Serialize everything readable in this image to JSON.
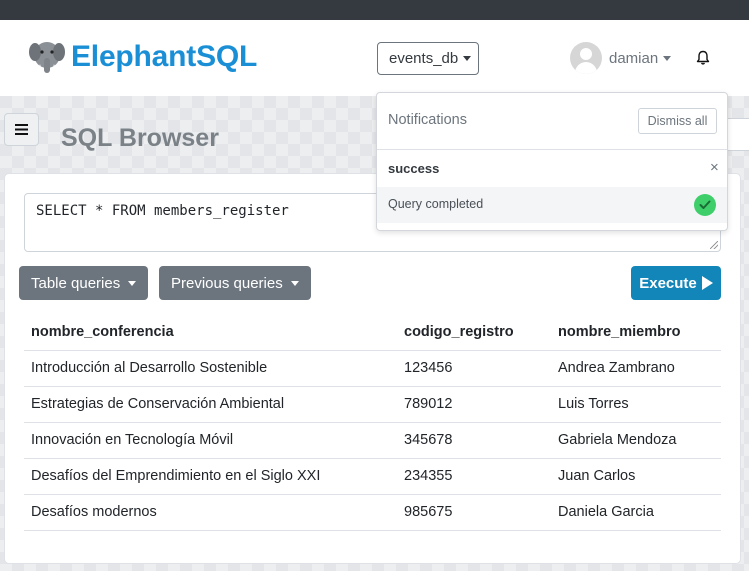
{
  "header": {
    "brand": "ElephantSQL",
    "database": "events_db",
    "username": "damian"
  },
  "page": {
    "title": "SQL Browser"
  },
  "editor": {
    "query": "SELECT * FROM members_register"
  },
  "toolbar": {
    "table_queries": "Table queries",
    "previous_queries": "Previous queries",
    "execute": "Execute"
  },
  "results": {
    "columns": [
      "nombre_conferencia",
      "codigo_registro",
      "nombre_miembro"
    ],
    "rows": [
      [
        "Introducción al Desarrollo Sostenible",
        "123456",
        "Andrea Zambrano"
      ],
      [
        "Estrategias de Conservación Ambiental",
        "789012",
        "Luis Torres"
      ],
      [
        "Innovación en Tecnología Móvil",
        "345678",
        "Gabriela Mendoza"
      ],
      [
        "Desafíos del Emprendimiento en el Siglo XXI",
        "234355",
        "Juan Carlos"
      ],
      [
        "Desafíos modernos",
        "985675",
        "Daniela Garcia"
      ]
    ]
  },
  "notifications": {
    "title": "Notifications",
    "dismiss_all": "Dismiss all",
    "items": [
      {
        "type": "success",
        "message": "Query completed",
        "icon": "check-circle-icon",
        "close": "×"
      }
    ]
  },
  "colors": {
    "brand": "#1a8fd6",
    "execute": "#1286b8",
    "secondary": "#6c757d",
    "success": "#3ecf6b"
  }
}
